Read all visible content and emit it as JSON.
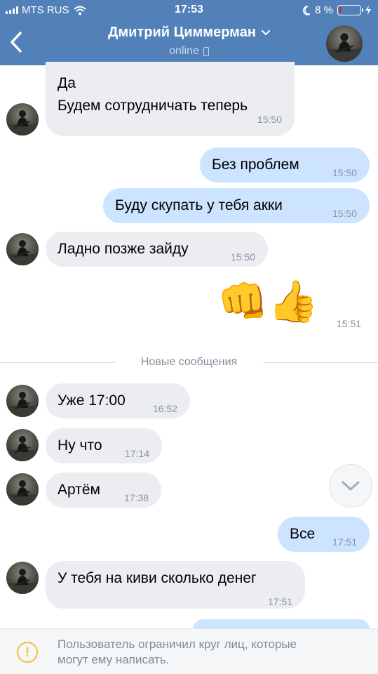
{
  "status_bar": {
    "carrier": "MTS RUS",
    "time": "17:53",
    "battery": "8 %"
  },
  "header": {
    "contact_name": "Дмитрий Циммерман",
    "status": "online"
  },
  "messages": [
    {
      "direction": "in",
      "text_line1": "Да",
      "text_line2": "Будем сотрудничать теперь",
      "time": "15:50"
    },
    {
      "direction": "out",
      "text": "Без проблем",
      "time": "15:50"
    },
    {
      "direction": "out",
      "text": "Буду скупать у тебя акки",
      "time": "15:50"
    },
    {
      "direction": "in",
      "text": "Ладно позже зайду",
      "time": "15:50"
    },
    {
      "direction": "out",
      "emoji": "👊👍",
      "time": "15:51"
    },
    {
      "direction": "in",
      "text": "Уже 17:00",
      "time": "16:52"
    },
    {
      "direction": "in",
      "text": "Ну что",
      "time": "17:14"
    },
    {
      "direction": "in",
      "text": "Артём",
      "time": "17:38"
    },
    {
      "direction": "out",
      "text": "Все",
      "time": "17:51"
    },
    {
      "direction": "in",
      "text": "У тебя на киви сколько денег",
      "time": "17:51"
    }
  ],
  "divider": {
    "label": "Новые сообщения"
  },
  "footer": {
    "notice_line1": "Пользователь ограничил круг лиц, которые",
    "notice_line2": "могут ему написать."
  },
  "colors": {
    "header_bg": "#5181b8",
    "incoming_bubble": "#ebedf0",
    "outgoing_bubble": "#cce4ff",
    "warning": "#f1c232"
  },
  "icons": {
    "back": "chevron-left-icon",
    "title_dropdown": "chevron-down-icon",
    "online_device": "phone-icon",
    "scroll_down": "chevron-down-icon",
    "notice": "warning-icon"
  }
}
